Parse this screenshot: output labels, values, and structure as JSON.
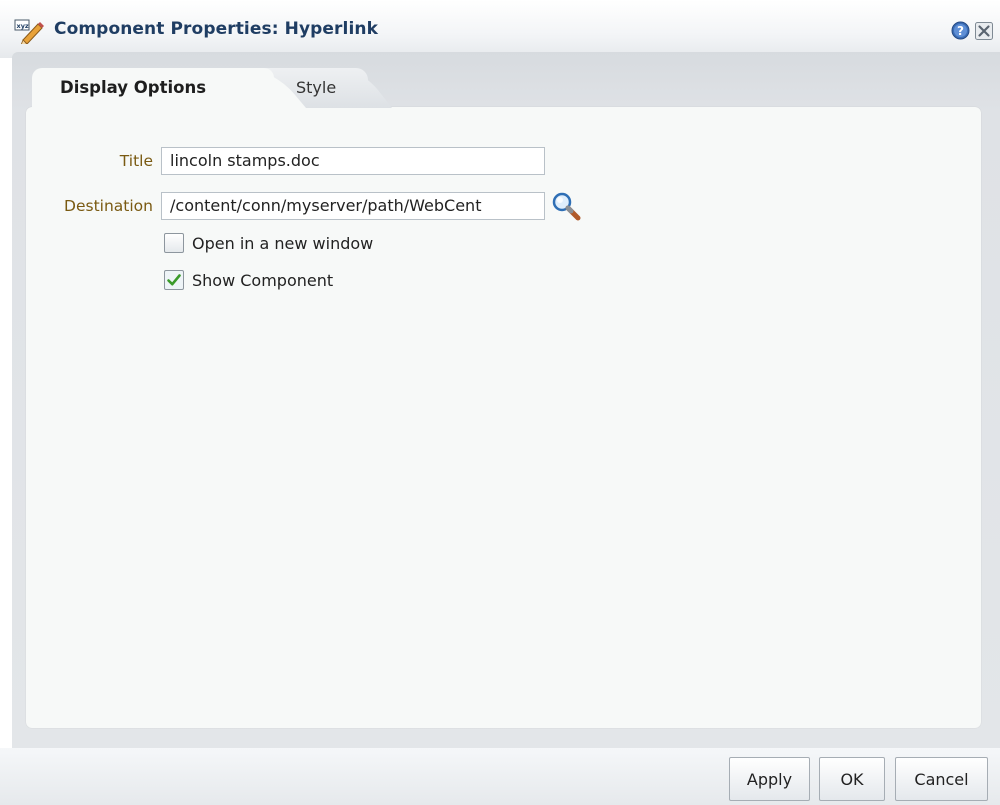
{
  "dialog": {
    "title": "Component Properties: Hyperlink",
    "icons": {
      "title": "edit-pencil-icon",
      "help": "help-icon",
      "close": "close-icon"
    },
    "accent_color": "#1f3d63"
  },
  "tabs": [
    {
      "label": "Display Options",
      "active": true
    },
    {
      "label": "Style",
      "active": false
    }
  ],
  "form": {
    "title": {
      "label": "Title",
      "value": "lincoln stamps.doc"
    },
    "destination": {
      "label": "Destination",
      "value": "/content/conn/myserver/path/WebCent",
      "search_icon": "search-icon"
    },
    "open_new_window": {
      "label": "Open in a new window",
      "checked": false
    },
    "show_component": {
      "label": "Show Component",
      "checked": true
    },
    "label_color": "#7a5a12"
  },
  "buttons": {
    "apply": "Apply",
    "ok": "OK",
    "cancel": "Cancel"
  }
}
